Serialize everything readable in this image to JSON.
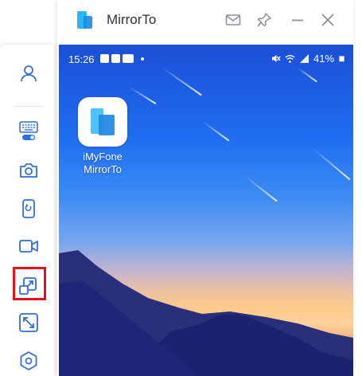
{
  "app": {
    "title": "MirrorTo"
  },
  "titlebar": {
    "icons": [
      "mail-icon",
      "pin-icon",
      "minimize-icon",
      "close-icon"
    ]
  },
  "phone": {
    "status": {
      "time": "15:26",
      "battery": "41%"
    },
    "home_app": {
      "label_line1": "iMyFone",
      "label_line2": "MirrorTo",
      "icon": "mirrorto-logo-icon"
    }
  },
  "sidebar": {
    "items": [
      {
        "name": "user-icon"
      },
      {
        "name": "keyboard-toggle-icon"
      },
      {
        "name": "camera-icon"
      },
      {
        "name": "phone-rotate-icon"
      },
      {
        "name": "video-record-icon"
      },
      {
        "name": "popout-window-icon",
        "highlighted": true
      },
      {
        "name": "fullscreen-icon"
      },
      {
        "name": "settings-icon"
      }
    ]
  },
  "colors": {
    "accent": "#1a73e8",
    "icon": "#2f6fd8",
    "highlight": "#e0141c",
    "logo_light": "#4fc3f7",
    "logo_dark": "#1e88e5"
  }
}
